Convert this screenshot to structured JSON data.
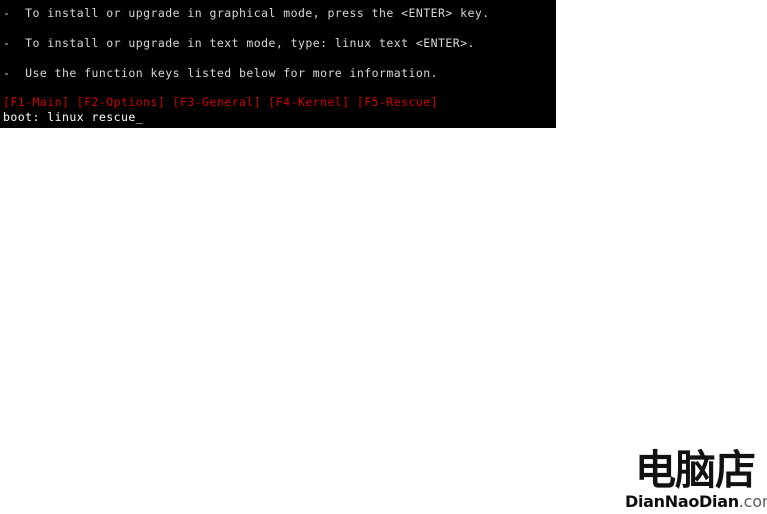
{
  "screen": {
    "background_color": "#ffffff",
    "terminal_background_color": "#000000",
    "terminal_text_color": "#d8d8d8",
    "function_key_color": "#d00000"
  },
  "boot_screen": {
    "options": [
      "-  To install or upgrade in graphical mode, press the <ENTER> key.",
      "-  To install or upgrade in text mode, type: linux text <ENTER>.",
      "-  Use the function keys listed below for more information."
    ],
    "function_keys_line": "[F1-Main] [F2-Options] [F3-General] [F4-Kernel] [F5-Rescue]",
    "function_keys": [
      "[F1-Main]",
      "[F2-Options]",
      "[F3-General]",
      "[F4-Kernel]",
      "[F5-Rescue]"
    ],
    "prompt_label": "boot:",
    "prompt_value": "linux rescue",
    "prompt_line": "boot: linux rescue_",
    "cursor": "_"
  },
  "watermark": {
    "logo_text": "电脑店",
    "domain_name": "DianNaoDian",
    "domain_tld": ".com",
    "domain_full": "DianNaoDian.com"
  }
}
